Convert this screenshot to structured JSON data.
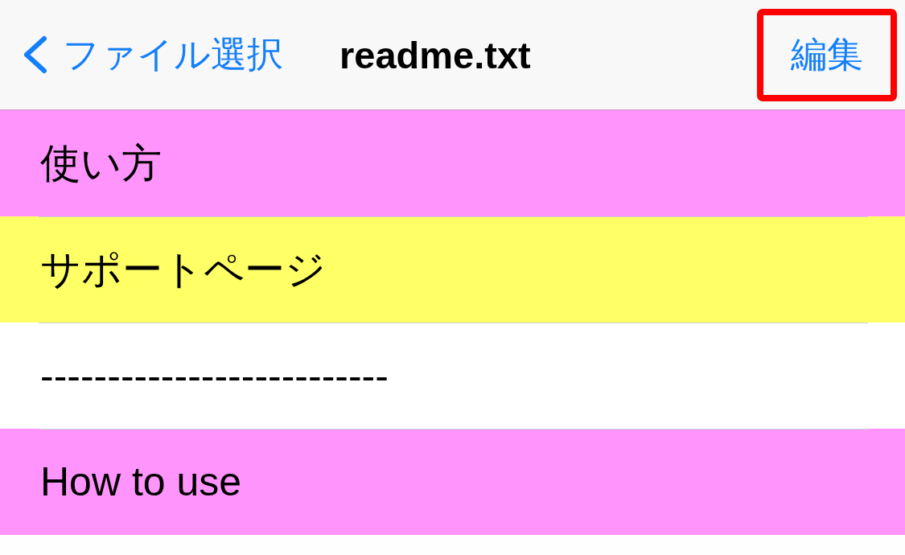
{
  "nav_bar": {
    "back_button": {
      "label": "ファイル選択"
    },
    "title": "readme.txt",
    "edit_button": {
      "label": "編集",
      "highlighted": true
    }
  },
  "rows": [
    {
      "text": "使い方",
      "color": "#ff94fc"
    },
    {
      "text": "サポートページ",
      "color": "#ffff66"
    },
    {
      "text": "--------------------------",
      "color": "#ffffff"
    },
    {
      "text": "How to use",
      "color": "#ff94fc"
    }
  ]
}
